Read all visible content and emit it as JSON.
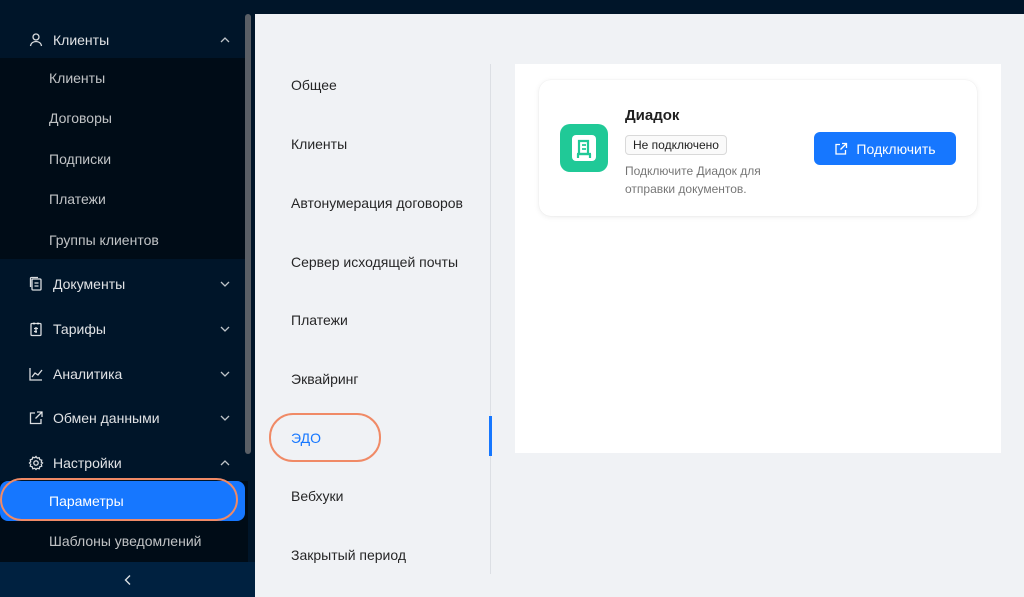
{
  "sidebar": {
    "groups": [
      {
        "label": "Клиенты",
        "icon": "user-icon",
        "expanded": true
      },
      {
        "label": "Документы",
        "icon": "document-icon",
        "expanded": false
      },
      {
        "label": "Тарифы",
        "icon": "tariff-icon",
        "expanded": false
      },
      {
        "label": "Аналитика",
        "icon": "chart-line-icon",
        "expanded": false
      },
      {
        "label": "Обмен данными",
        "icon": "exchange-icon",
        "expanded": false
      },
      {
        "label": "Настройки",
        "icon": "gear-icon",
        "expanded": true
      }
    ],
    "clients_sub": [
      "Клиенты",
      "Договоры",
      "Подписки",
      "Платежи",
      "Группы клиентов"
    ],
    "settings_sub": [
      "Параметры",
      "Шаблоны уведомлений"
    ],
    "active_item": "Параметры"
  },
  "settings_nav": {
    "items": [
      "Общее",
      "Клиенты",
      "Автонумерация договоров",
      "Сервер исходящей почты",
      "Платежи",
      "Эквайринг",
      "ЭДО",
      "Вебхуки",
      "Закрытый период"
    ],
    "active": "ЭДО"
  },
  "integration": {
    "title": "Диадок",
    "status": "Не подключено",
    "description": "Подключите Диадок для отправки документов.",
    "button_label": "Подключить"
  },
  "colors": {
    "sidebar_bg": "#001529",
    "accent": "#1677ff",
    "logo_bg": "#20c997",
    "highlight": "#f08a66"
  }
}
